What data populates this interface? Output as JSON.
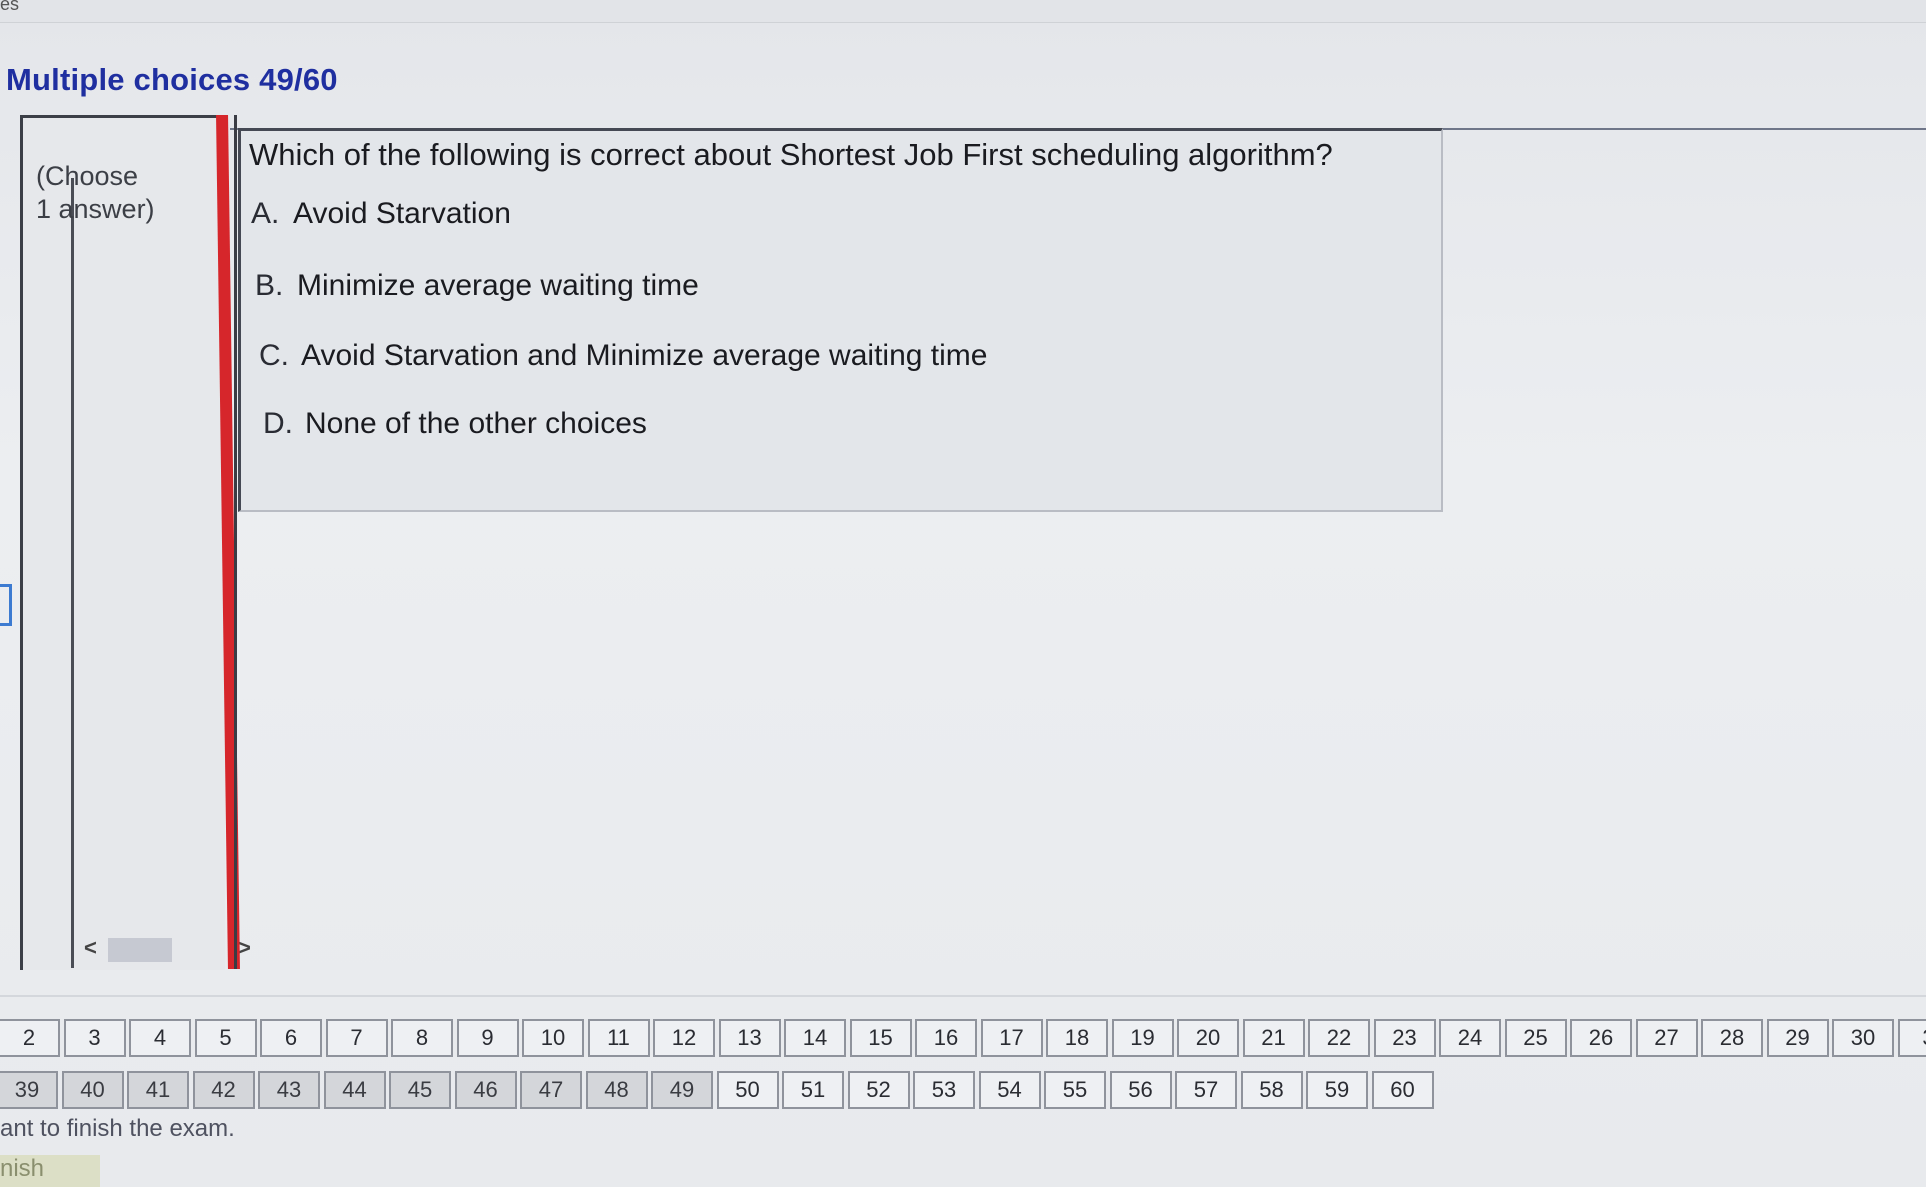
{
  "header": {
    "top_fragment": "es",
    "section_title": "Multiple choices 49/60"
  },
  "left_panel": {
    "instruction": "(Choose 1 answer)",
    "scroll_left": "<",
    "scroll_right": ">"
  },
  "question": {
    "text": "Which of the following is correct about Shortest Job First scheduling algorithm?",
    "options": [
      {
        "letter": "A.",
        "text": "Avoid Starvation"
      },
      {
        "letter": "B.",
        "text": "Minimize average waiting time"
      },
      {
        "letter": "C.",
        "text": "Avoid Starvation and Minimize average waiting time"
      },
      {
        "letter": "D.",
        "text": "None of the other choices"
      }
    ]
  },
  "navigation": {
    "row1": [
      "2",
      "3",
      "4",
      "5",
      "6",
      "7",
      "8",
      "9",
      "10",
      "11",
      "12",
      "13",
      "14",
      "15",
      "16",
      "17",
      "18",
      "19",
      "20",
      "21",
      "22",
      "23",
      "24",
      "25",
      "26",
      "27",
      "28",
      "29",
      "30",
      "3"
    ],
    "row2": [
      "39",
      "40",
      "41",
      "42",
      "43",
      "44",
      "45",
      "46",
      "47",
      "48",
      "49",
      "50",
      "51",
      "52",
      "53",
      "54",
      "55",
      "56",
      "57",
      "58",
      "59",
      "60"
    ]
  },
  "footer": {
    "finish_message": "ant to finish the exam.",
    "finish_button": "nish"
  }
}
